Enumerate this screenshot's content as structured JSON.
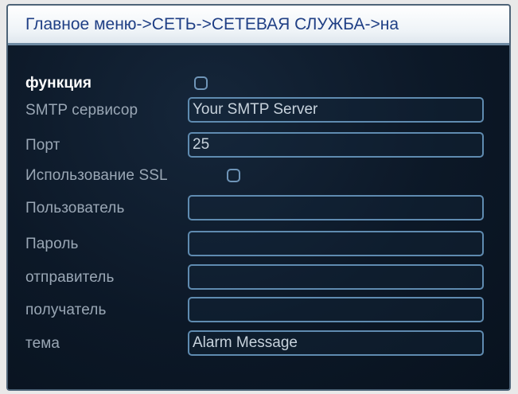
{
  "title": "Главное меню->СЕТЬ->СЕТЕВАЯ СЛУЖБА->на",
  "fields": {
    "function": {
      "label": "функция",
      "checked": false
    },
    "smtp_server": {
      "label": "SMTP сервисор",
      "value": "Your SMTP Server"
    },
    "port": {
      "label": "Порт",
      "value": "25"
    },
    "ssl": {
      "label": "Использование SSL",
      "checked": false
    },
    "user": {
      "label": "Пользователь",
      "value": ""
    },
    "password": {
      "label": "Пароль",
      "value": ""
    },
    "sender": {
      "label": "отправитель",
      "value": ""
    },
    "recipient": {
      "label": "получатель",
      "value": ""
    },
    "subject": {
      "label": "тема",
      "value": "Alarm Message"
    }
  }
}
